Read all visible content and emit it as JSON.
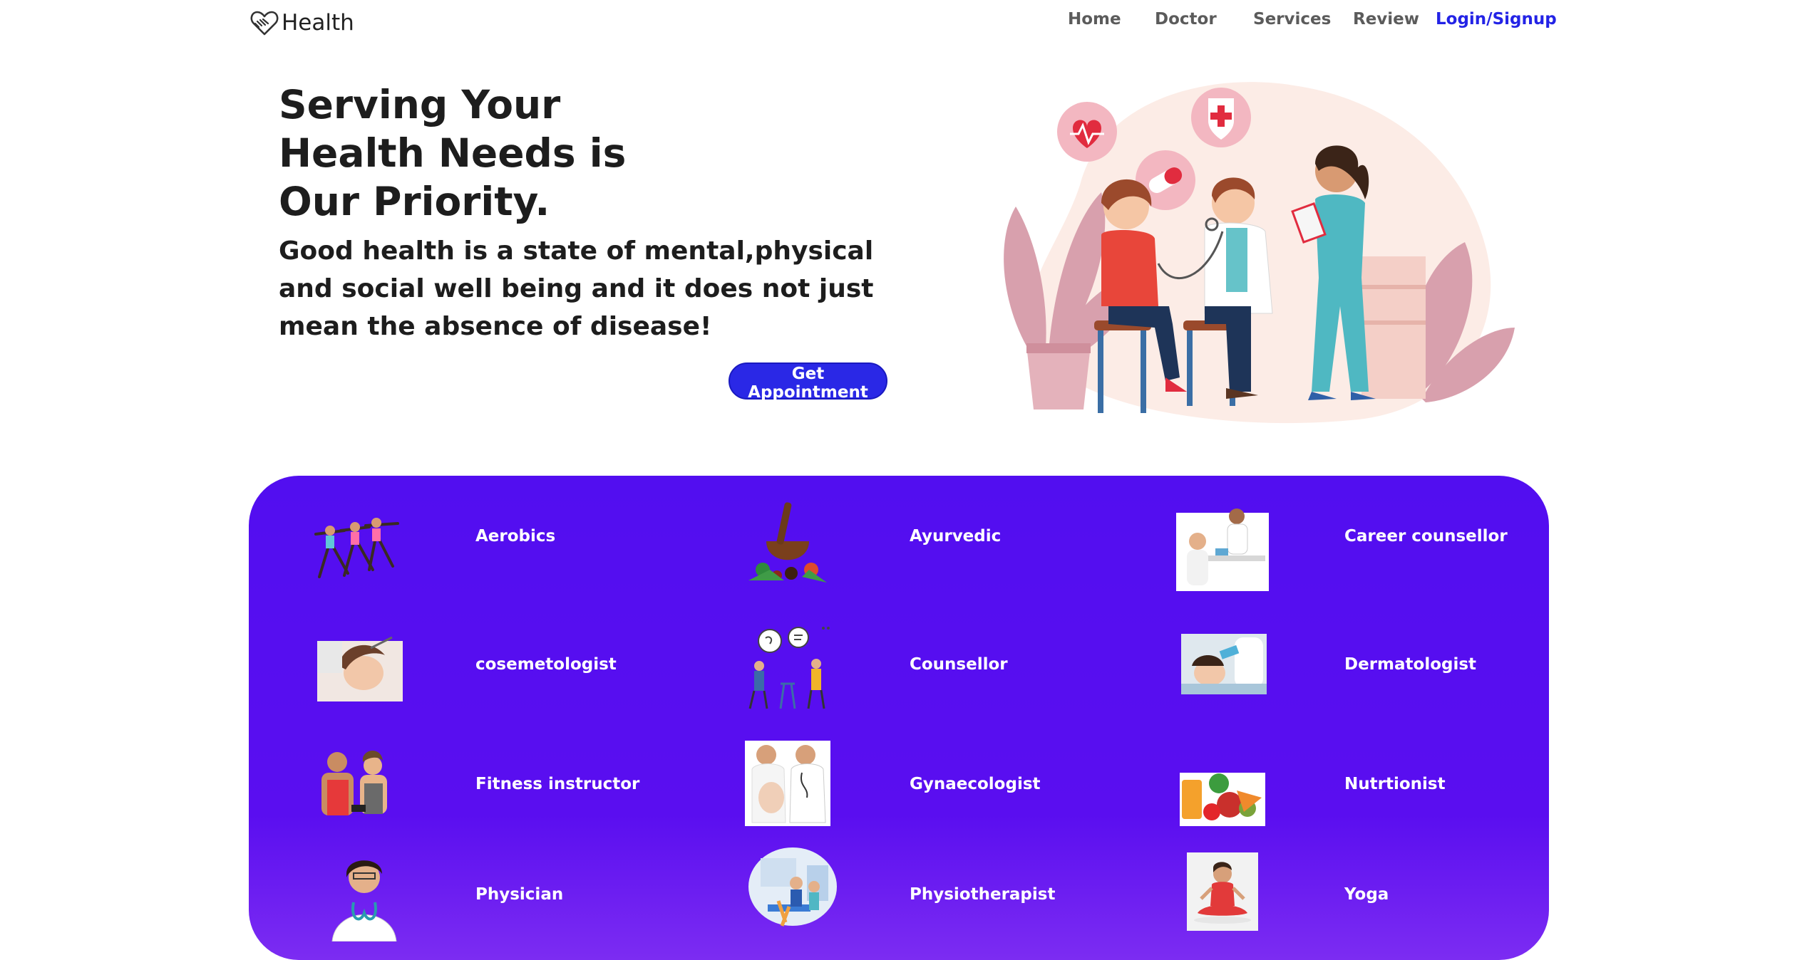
{
  "brand": {
    "name": "Health",
    "icon": "heart-handshake-icon"
  },
  "nav": {
    "links": [
      "Home",
      "Doctor",
      "Services",
      "Review"
    ],
    "login": "Login/Signup"
  },
  "hero": {
    "title_lines": [
      "Serving Your",
      "Health Needs is",
      "Our Priority."
    ],
    "subtitle": "Good health is a state of mental,physical and social well being and it does not just mean the absence of disease!",
    "cta": "Get Appointment",
    "illustration": "doctor-checkup-illustration"
  },
  "services": [
    {
      "label": "Aerobics",
      "image": "aerobics-image"
    },
    {
      "label": "Ayurvedic",
      "image": "ayurvedic-image"
    },
    {
      "label": "Career counsellor",
      "image": "career-counsellor-image"
    },
    {
      "label": "cosemetologist",
      "image": "cosmetologist-image"
    },
    {
      "label": "Counsellor",
      "image": "counsellor-image"
    },
    {
      "label": "Dermatologist",
      "image": "dermatologist-image"
    },
    {
      "label": "Fitness instructor",
      "image": "fitness-instructor-image"
    },
    {
      "label": "Gynaecologist",
      "image": "gynaecologist-image"
    },
    {
      "label": "Nutrtionist",
      "image": "nutritionist-image"
    },
    {
      "label": "Physician",
      "image": "physician-image"
    },
    {
      "label": "Physiotherapist",
      "image": "physiotherapist-image"
    },
    {
      "label": "Yoga",
      "image": "yoga-image"
    }
  ],
  "colors": {
    "accent": "#2a28e6",
    "panel": "#540ef0",
    "login_link": "#2323e6"
  }
}
